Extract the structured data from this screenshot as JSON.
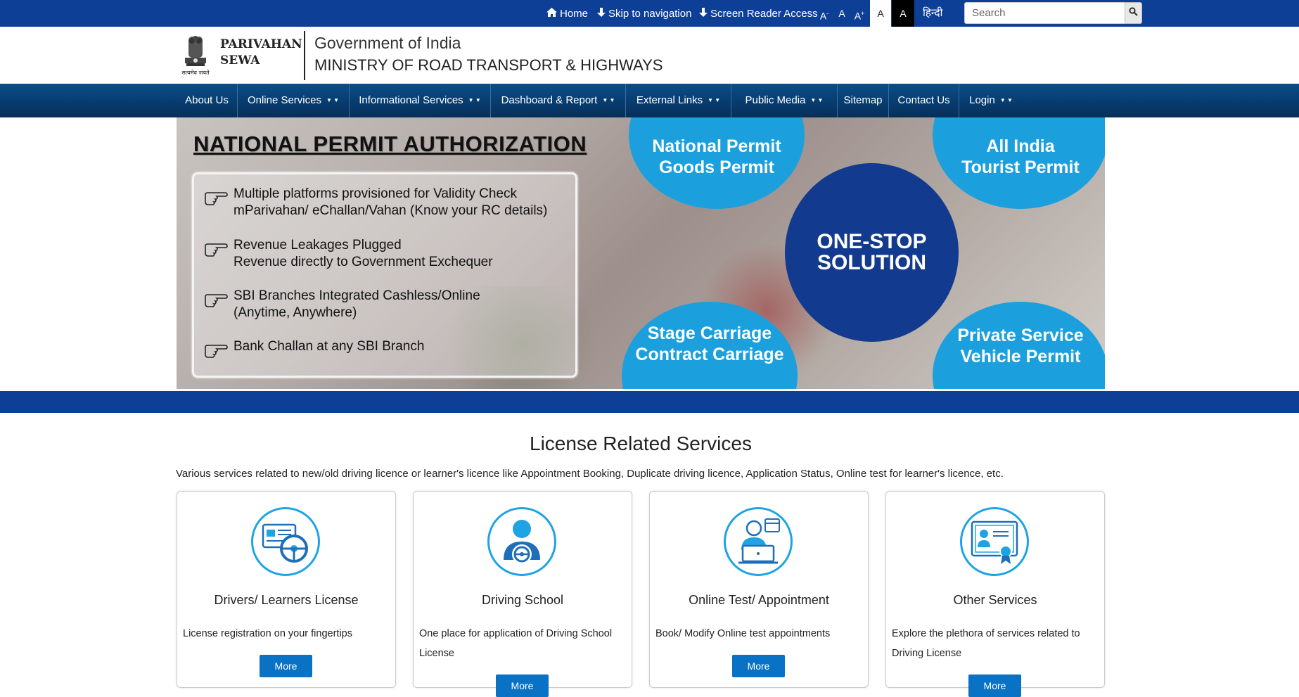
{
  "topbar": {
    "home": "Home",
    "skip_nav": "Skip to navigation",
    "screen_reader": "Screen Reader Access",
    "font_minus": "A",
    "font_normal": "A",
    "font_plus": "A",
    "theme_light": "A",
    "theme_dark": "A",
    "hindi": "हिन्दी",
    "search_placeholder": "Search"
  },
  "header": {
    "brand_line1": "PARIVAHAN",
    "brand_line2": "SEWA",
    "emblem_caption": "सत्यमेव जयते",
    "gov": "Government of India",
    "ministry": "MINISTRY OF ROAD TRANSPORT & HIGHWAYS"
  },
  "nav": {
    "items": [
      {
        "label": "About Us",
        "dropdown": false
      },
      {
        "label": "Online Services",
        "dropdown": true
      },
      {
        "label": "Informational Services",
        "dropdown": true
      },
      {
        "label": "Dashboard & Report",
        "dropdown": true
      },
      {
        "label": "External Links",
        "dropdown": true
      },
      {
        "label": "Public Media",
        "dropdown": true
      },
      {
        "label": "Sitemap",
        "dropdown": false
      },
      {
        "label": "Contact Us",
        "dropdown": false
      },
      {
        "label": "Login",
        "dropdown": true
      }
    ]
  },
  "banner": {
    "title": "NATIONAL PERMIT AUTHORIZATION",
    "features": [
      {
        "line1": "Multiple platforms provisioned for Validity Check",
        "line2": "mParivahan/ eChallan/Vahan (Know your RC details)"
      },
      {
        "line1": "Revenue Leakages Plugged",
        "line2": "Revenue directly to Government Exchequer"
      },
      {
        "line1": "SBI Branches Integrated Cashless/Online",
        "line2": "(Anytime, Anywhere)"
      },
      {
        "line1": "Bank Challan at any SBI Branch",
        "line2": ""
      }
    ],
    "circles": {
      "top_left": {
        "line1": "National Permit",
        "line2": "Goods Permit"
      },
      "top_right": {
        "line1": "All India",
        "line2": "Tourist Permit"
      },
      "center": {
        "line1": "ONE-STOP",
        "line2": "SOLUTION"
      },
      "bottom_left": {
        "line1": "Stage Carriage",
        "line2": "Contract Carriage"
      },
      "bottom_right": {
        "line1": "Private Service",
        "line2": "Vehicle Permit"
      }
    },
    "colors": {
      "light_circle": "#1ca0dd",
      "dark_circle": "#123a8e"
    }
  },
  "license_section": {
    "title": "License Related Services",
    "description": "Various services related to new/old driving licence or learner's licence like Appointment Booking, Duplicate driving licence, Application Status, Online test for learner's licence, etc.",
    "cards": [
      {
        "title": "Drivers/ Learners License",
        "description": "License registration on your fingertips",
        "button": "More",
        "icon": "license-steering-icon"
      },
      {
        "title": "Driving School",
        "description": "One place for application of Driving School License",
        "button": "More",
        "icon": "driver-icon"
      },
      {
        "title": "Online Test/ Appointment",
        "description": "Book/ Modify Online test appointments",
        "button": "More",
        "icon": "online-test-icon"
      },
      {
        "title": "Other Services",
        "description": "Explore the plethora of services related to Driving License",
        "button": "More",
        "icon": "certificate-icon"
      }
    ]
  },
  "colors": {
    "topbar": "#0e3f97",
    "nav": "#0a4d8a",
    "accent": "#1ea3e5",
    "button": "#0a72c4"
  }
}
